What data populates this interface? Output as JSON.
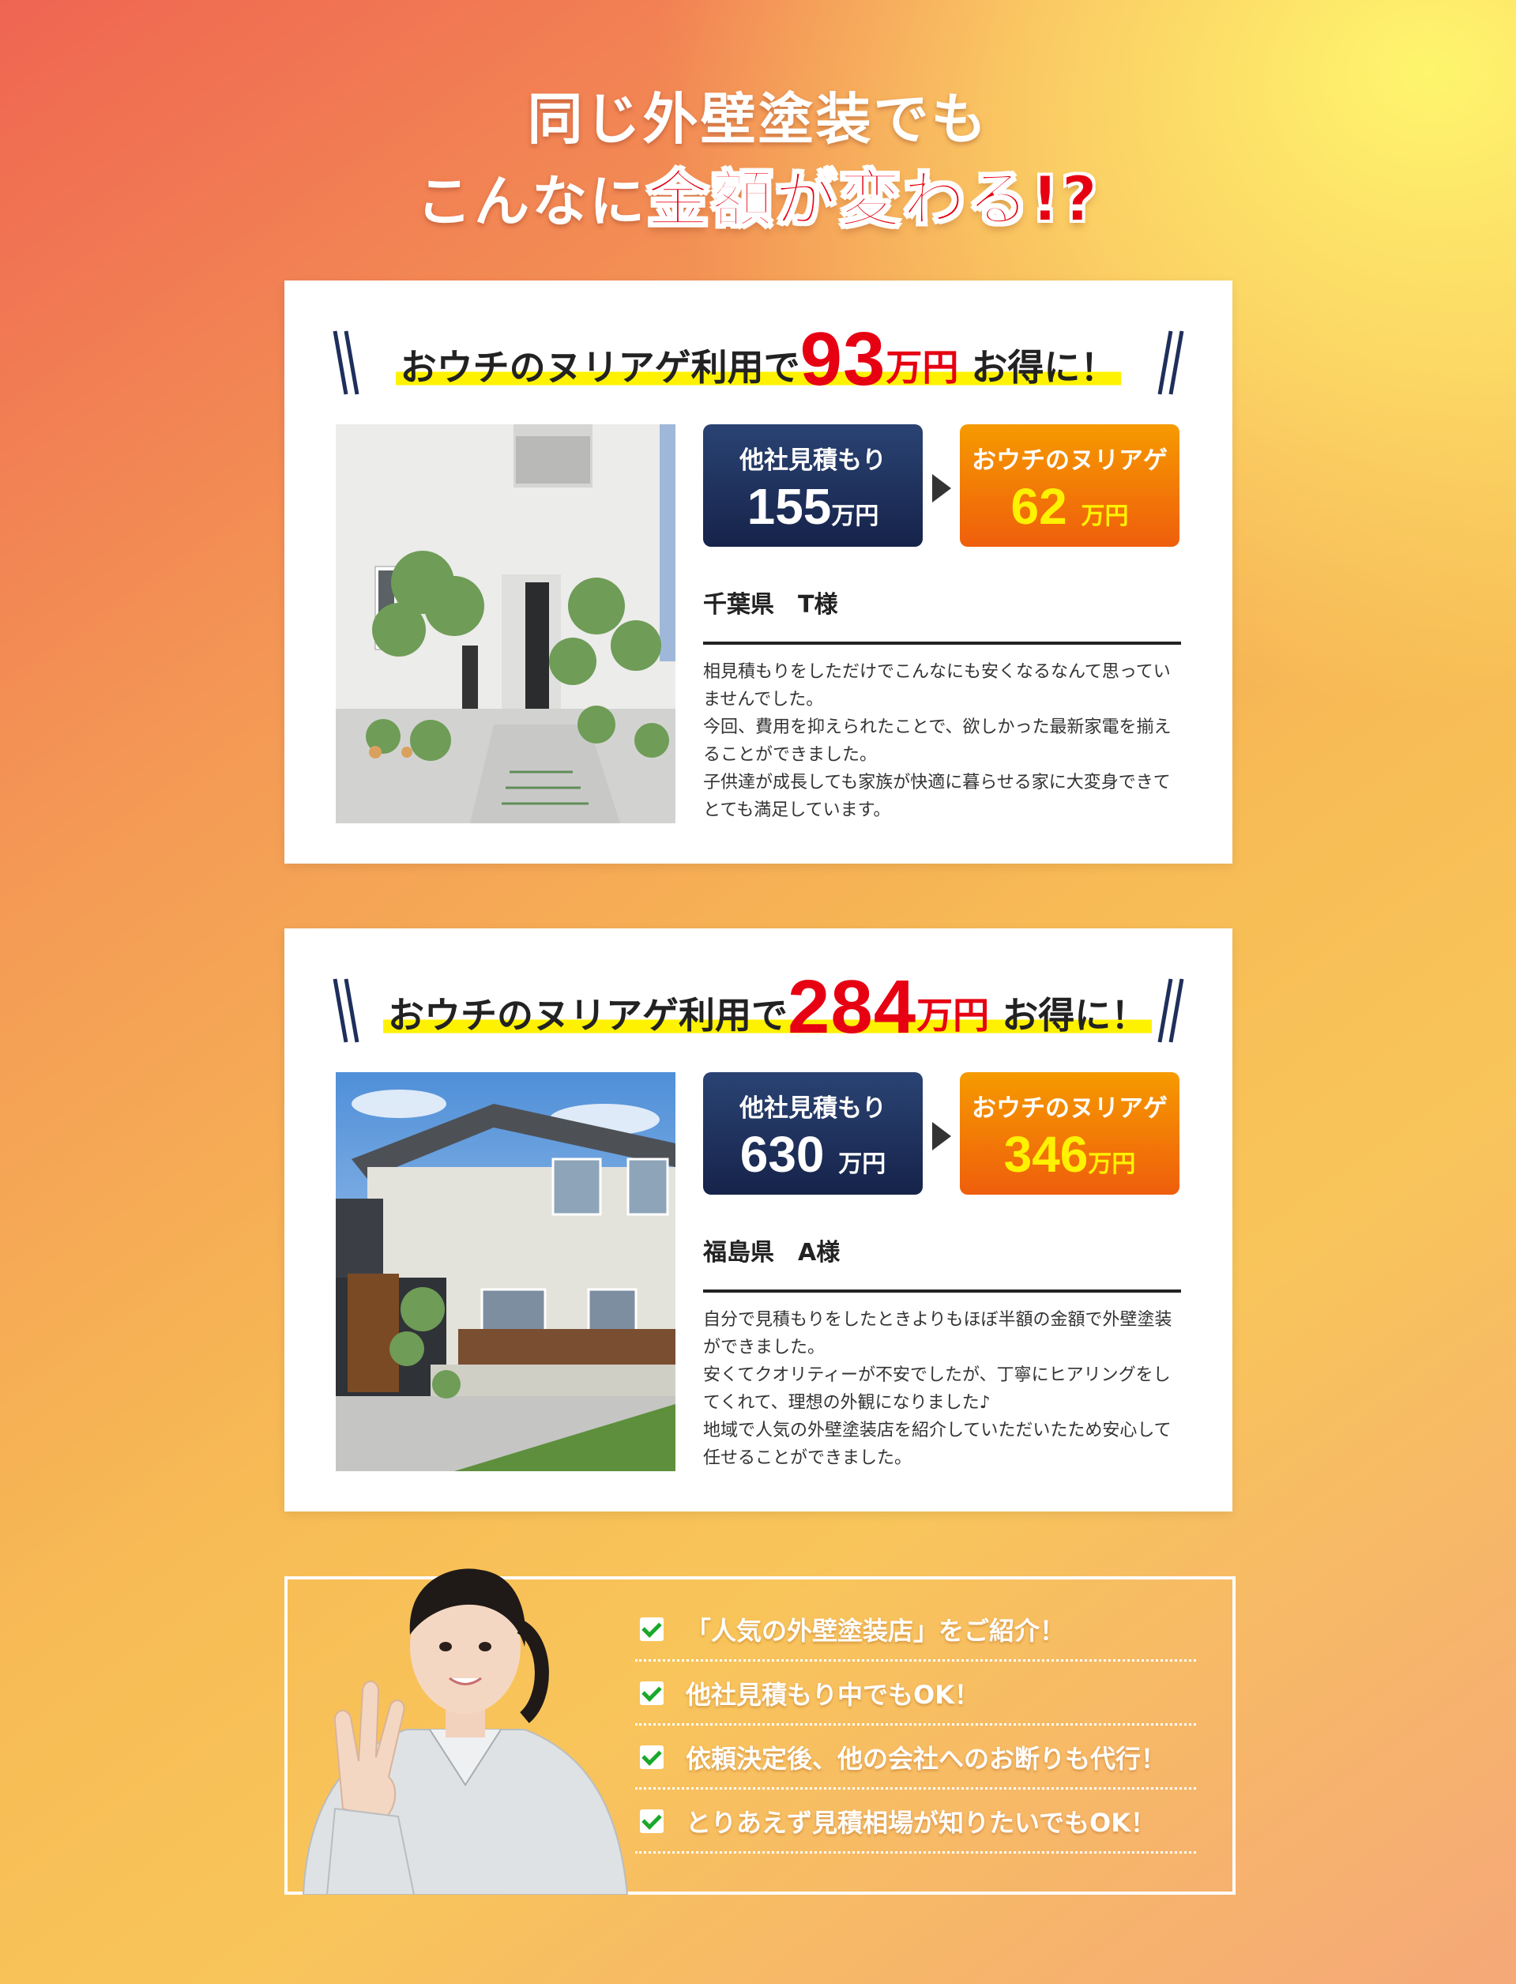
{
  "headline": {
    "line1": "同じ外壁塗装でも",
    "line2_prefix": "こんなに",
    "line2_red": "金額が変わる!?"
  },
  "cases": [
    {
      "title_prefix": "おウチのヌリアゲ利用で",
      "savings_number": "93",
      "savings_unit": "万円",
      "title_suffix": "お得に！",
      "other_label": "他社見積もり",
      "other_price": "155",
      "other_unit": "万円",
      "ours_label": "おウチのヌリアゲ",
      "ours_price": "62",
      "ours_unit": "万円",
      "customer": "千葉県　T様",
      "review": [
        "相見積もりをしただけでこんなにも安くなるなんて思っていませんでした。",
        "今回、費用を抑えられたことで、欲しかった最新家電を揃えることができました。",
        "子供達が成長しても家族が快適に暮らせる家に大変身できてとても満足しています。"
      ]
    },
    {
      "title_prefix": "おウチのヌリアゲ利用で",
      "savings_number": "284",
      "savings_unit": "万円",
      "title_suffix": "お得に！",
      "other_label": "他社見積もり",
      "other_price": "630",
      "other_unit": "万円",
      "ours_label": "おウチのヌリアゲ",
      "ours_price": "346",
      "ours_unit": "万円",
      "customer": "福島県　A様",
      "review": [
        "自分で見積もりをしたときよりもほぼ半額の金額で外壁塗装ができました。",
        "安くてクオリティーが不安でしたが、丁寧にヒアリングをしてくれて、理想の外観になりました♪",
        "地域で人気の外壁塗装店を紹介していただいたため安心して任せることができました。"
      ]
    }
  ],
  "features": [
    "「人気の外壁塗装店」をご紹介！",
    "他社見積もり中でもOK！",
    "依頼決定後、他の会社へのお断りも代行！",
    "とりあえず見積相場が知りたいでもOK！"
  ],
  "colors": {
    "accent_red": "#e60012",
    "navy": "#16234a",
    "orange": "#ef5e0c",
    "highlight_yellow": "#fff200",
    "check_green": "#1aa82a"
  },
  "icons": [
    "check-icon",
    "arrow-right-icon",
    "slash-decoration-icon"
  ]
}
